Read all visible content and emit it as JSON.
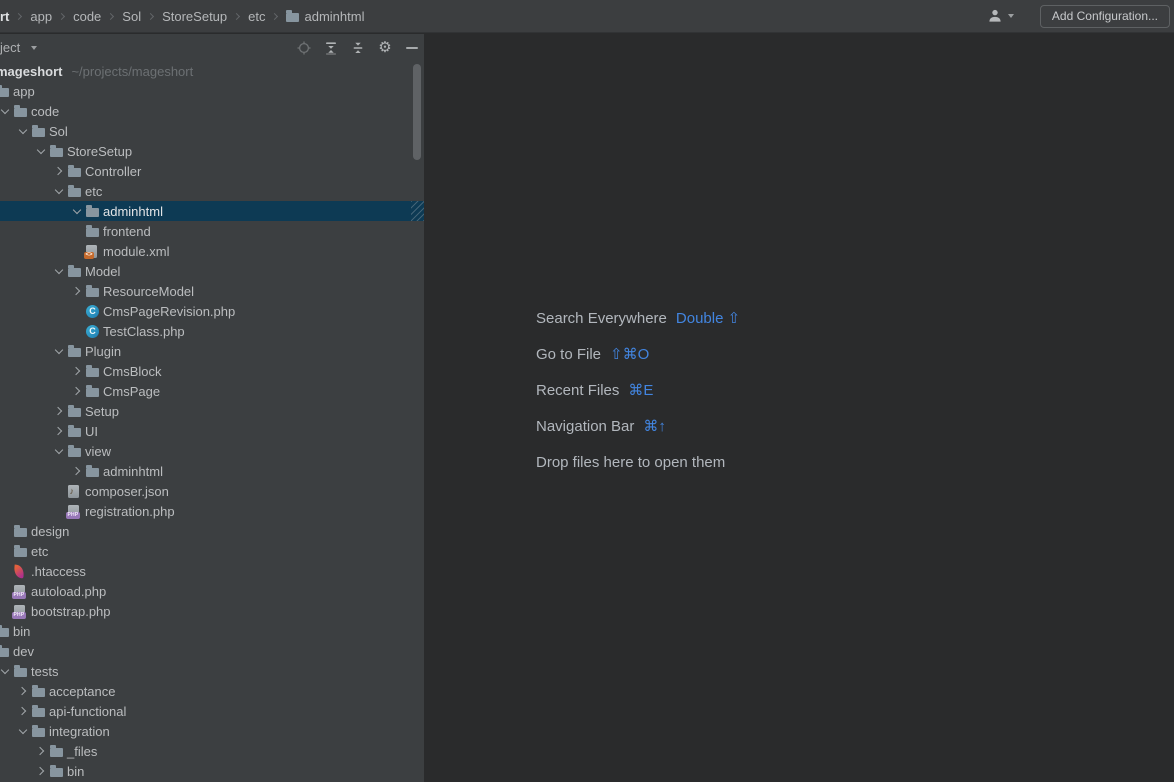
{
  "topbar": {
    "breadcrumbs": [
      {
        "label": "rt",
        "bold": true
      },
      {
        "label": "app"
      },
      {
        "label": "code"
      },
      {
        "label": "Sol"
      },
      {
        "label": "StoreSetup"
      },
      {
        "label": "etc"
      },
      {
        "label": "adminhtml",
        "icon": "folder"
      }
    ],
    "add_configuration_label": "Add Configuration...",
    "user_icon": "user-icon"
  },
  "project_panel": {
    "title": "ject",
    "header_icons": [
      "locate-target-icon",
      "expand-all-icon",
      "collapse-all-icon",
      "gear-icon",
      "hide-panel-icon"
    ],
    "tree": [
      {
        "type": "root",
        "label": "mageshort",
        "path": "~/projects/mageshort"
      },
      {
        "label": "app",
        "level": 1,
        "icon": "folder",
        "arrow": "expanded"
      },
      {
        "label": "code",
        "level": 2,
        "icon": "folder",
        "arrow": "expanded"
      },
      {
        "label": "Sol",
        "level": 3,
        "icon": "folder",
        "arrow": "expanded"
      },
      {
        "label": "StoreSetup",
        "level": 4,
        "icon": "folder",
        "arrow": "expanded"
      },
      {
        "label": "Controller",
        "level": 5,
        "icon": "folder",
        "arrow": "collapsed"
      },
      {
        "label": "etc",
        "level": 5,
        "icon": "folder",
        "arrow": "expanded"
      },
      {
        "label": "adminhtml",
        "level": 6,
        "icon": "folder",
        "arrow": "expanded",
        "selected": true
      },
      {
        "label": "frontend",
        "level": 6,
        "icon": "folder",
        "arrow": "none"
      },
      {
        "label": "module.xml",
        "level": 6,
        "icon": "xml",
        "arrow": "none"
      },
      {
        "label": "Model",
        "level": 5,
        "icon": "folder",
        "arrow": "expanded"
      },
      {
        "label": "ResourceModel",
        "level": 6,
        "icon": "folder",
        "arrow": "collapsed"
      },
      {
        "label": "CmsPageRevision.php",
        "level": 6,
        "icon": "class",
        "arrow": "none"
      },
      {
        "label": "TestClass.php",
        "level": 6,
        "icon": "class",
        "arrow": "none"
      },
      {
        "label": "Plugin",
        "level": 5,
        "icon": "folder",
        "arrow": "expanded"
      },
      {
        "label": "CmsBlock",
        "level": 6,
        "icon": "folder",
        "arrow": "collapsed"
      },
      {
        "label": "CmsPage",
        "level": 6,
        "icon": "folder",
        "arrow": "collapsed"
      },
      {
        "label": "Setup",
        "level": 5,
        "icon": "folder",
        "arrow": "collapsed"
      },
      {
        "label": "UI",
        "level": 5,
        "icon": "folder",
        "arrow": "collapsed"
      },
      {
        "label": "view",
        "level": 5,
        "icon": "folder",
        "arrow": "expanded"
      },
      {
        "label": "adminhtml",
        "level": 6,
        "icon": "folder",
        "arrow": "collapsed"
      },
      {
        "label": "composer.json",
        "level": 5,
        "icon": "composer",
        "arrow": "none"
      },
      {
        "label": "registration.php",
        "level": 5,
        "icon": "php",
        "arrow": "none"
      },
      {
        "label": "design",
        "level": 2,
        "icon": "folder",
        "arrow": "none"
      },
      {
        "label": "etc",
        "level": 2,
        "icon": "folder",
        "arrow": "none"
      },
      {
        "label": ".htaccess",
        "level": 2,
        "icon": "htaccess",
        "arrow": "none"
      },
      {
        "label": "autoload.php",
        "level": 2,
        "icon": "php",
        "arrow": "none"
      },
      {
        "label": "bootstrap.php",
        "level": 2,
        "icon": "php",
        "arrow": "none"
      },
      {
        "label": "bin",
        "level": 1,
        "icon": "folder",
        "arrow": "none"
      },
      {
        "label": "dev",
        "level": 1,
        "icon": "folder",
        "arrow": "expanded"
      },
      {
        "label": "tests",
        "level": 2,
        "icon": "folder",
        "arrow": "expanded"
      },
      {
        "label": "acceptance",
        "level": 3,
        "icon": "folder",
        "arrow": "collapsed"
      },
      {
        "label": "api-functional",
        "level": 3,
        "icon": "folder",
        "arrow": "collapsed"
      },
      {
        "label": "integration",
        "level": 3,
        "icon": "folder",
        "arrow": "expanded"
      },
      {
        "label": "_files",
        "level": 4,
        "icon": "folder",
        "arrow": "collapsed"
      },
      {
        "label": "bin",
        "level": 4,
        "icon": "folder",
        "arrow": "collapsed"
      }
    ]
  },
  "editor": {
    "shortcuts": [
      {
        "label": "Search Everywhere",
        "keys": "Double ⇧"
      },
      {
        "label": "Go to File",
        "keys": "⇧⌘O"
      },
      {
        "label": "Recent Files",
        "keys": "⌘E"
      },
      {
        "label": "Navigation Bar",
        "keys": "⌘↑"
      },
      {
        "label": "Drop files here to open them",
        "keys": ""
      }
    ]
  },
  "colors": {
    "panel_bg": "#3C3F41",
    "topbar_bg": "#3C3E40",
    "editor_bg": "#2A2B2C",
    "selection": "#0D3A54",
    "accent_blue": "#4285E0",
    "folder": "#87959F"
  }
}
